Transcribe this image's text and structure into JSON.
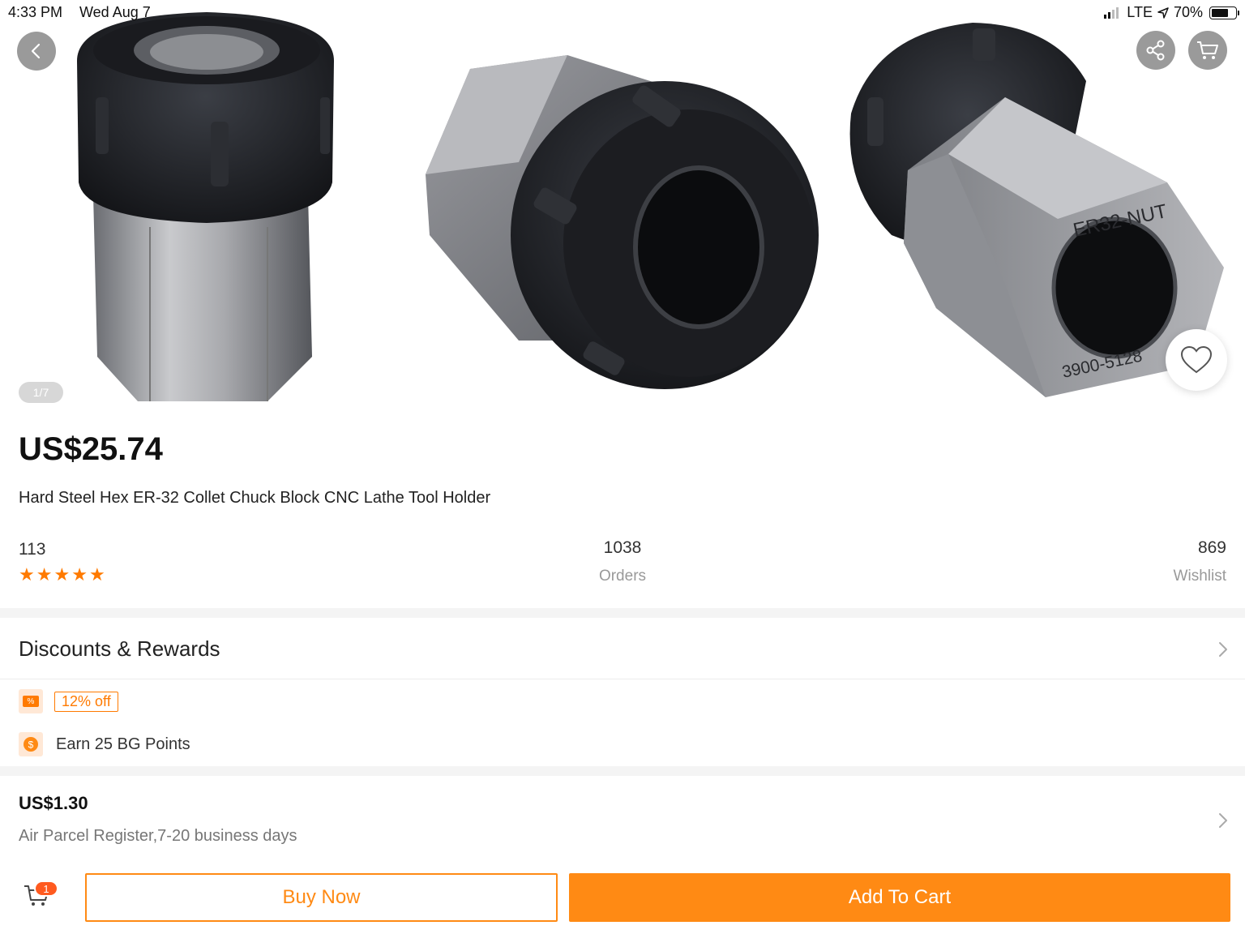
{
  "status_bar": {
    "time": "4:33 PM",
    "date": "Wed Aug 7",
    "network": "LTE",
    "battery": "70%"
  },
  "gallery": {
    "page_indicator": "1/7",
    "image_labels": {
      "nut_text": "ER32-NUT",
      "part_number": "3900-5128"
    }
  },
  "product": {
    "price": "US$25.74",
    "title": "Hard Steel Hex ER-32 Collet Chuck Block CNC Lathe Tool Holder",
    "rating_stars": 5,
    "reviews_count": "113",
    "orders_count": "1038",
    "orders_label": "Orders",
    "wishlist_count": "869",
    "wishlist_label": "Wishlist"
  },
  "discounts": {
    "title": "Discounts & Rewards",
    "coupon_icon_text": "%",
    "coupon": "12% off",
    "points": "Earn 25 BG Points"
  },
  "shipping": {
    "price": "US$1.30",
    "method": "Air Parcel Register,7-20 business days"
  },
  "bottom_bar": {
    "cart_badge": "1",
    "buy_now": "Buy Now",
    "add_to_cart": "Add To Cart"
  },
  "colors": {
    "accent": "#ff8a14",
    "star": "#ff7a00",
    "badge": "#ff5a1f"
  }
}
